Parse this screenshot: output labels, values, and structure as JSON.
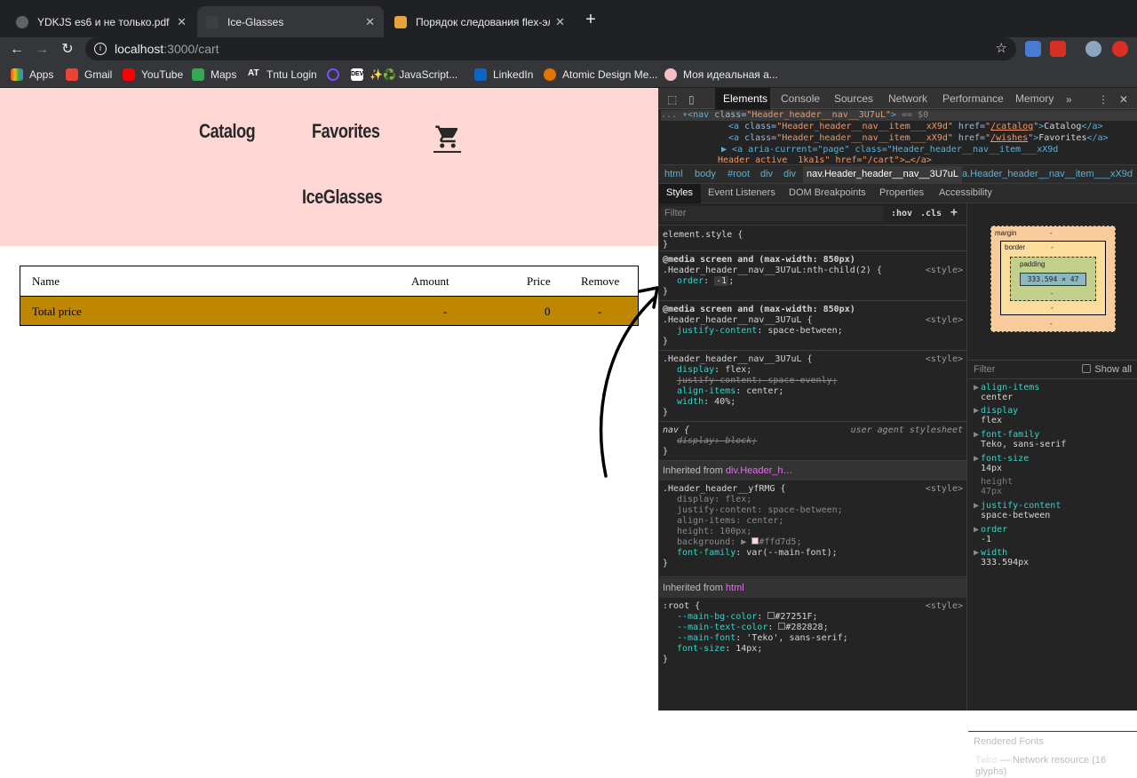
{
  "browser": {
    "tabs": [
      {
        "title": "YDKJS es6 и не только.pdf",
        "active": false
      },
      {
        "title": "Ice-Glasses",
        "active": true
      },
      {
        "title": "Порядок следования flex-эле",
        "active": false
      }
    ],
    "url_host": "localhost",
    "url_path": ":3000/cart",
    "bookmarks": [
      "Apps",
      "Gmail",
      "YouTube",
      "Maps",
      "Tntu Login",
      "",
      "✨♻️ JavaScript...",
      "LinkedIn",
      "Atomic Design Me...",
      "Моя идеальная а..."
    ]
  },
  "header": {
    "catalog": "Catalog",
    "favorites": "Favorites",
    "brand": "IceGlasses"
  },
  "cart_table": {
    "headers": {
      "name": "Name",
      "amount": "Amount",
      "price": "Price",
      "remove": "Remove"
    },
    "total": {
      "label": "Total price",
      "amount": "-",
      "price": "0",
      "remove": "-"
    }
  },
  "devtools": {
    "tabs": [
      "Elements",
      "Console",
      "Sources",
      "Network",
      "Performance",
      "Memory"
    ],
    "dom_lines": [
      {
        "prefix": "... ▾",
        "tag": "nav",
        "cls": "Header_header__nav__3U7uL",
        "suffix": "== $0"
      },
      {
        "a_cls": "Header_header__nav__item___xX9d",
        "href": "/catalog",
        "text": "Catalog"
      },
      {
        "a_cls": "Header_header__nav__item___xX9d",
        "href": "/wishes",
        "text": "Favorites"
      },
      {
        "line": "▶ <a aria-current=\"page\" class=\"Header_header__nav__item___xX9d"
      },
      {
        "line": "Header_active__1ka1s\" href=\"/cart\">…</a>"
      }
    ],
    "breadcrumbs": [
      "html",
      "body",
      "#root",
      "div",
      "div",
      "nav.Header_header__nav__3U7uL",
      "a.Header_header__nav__item___xX9d"
    ],
    "subtabs": [
      "Styles",
      "Event Listeners",
      "DOM Breakpoints",
      "Properties",
      "Accessibility"
    ],
    "filter_placeholder": "Filter",
    "hov": ":hov",
    "cls": ".cls",
    "rules": {
      "element_style": "element.style {",
      "media1": "@media screen and (max-width: 850px)",
      "sel1": ".Header_header__nav__3U7uL:nth-child(2) {",
      "p1": "order",
      "v1": "-1",
      "media2": "@media screen and (max-width: 850px)",
      "sel2": ".Header_header__nav__3U7uL {",
      "p2": "justify-content",
      "v2": "space-between",
      "sel3": ".Header_header__nav__3U7uL {",
      "p3a": "display",
      "v3a": "flex",
      "p3b": "justify-content",
      "v3b": "space-evenly",
      "p3c": "align-items",
      "v3c": "center",
      "p3d": "width",
      "v3d": "40%",
      "sel4": "nav {",
      "ua": "user agent stylesheet",
      "p4": "display",
      "v4": "block",
      "inh1_prefix": "Inherited from ",
      "inh1": "div.Header_h…",
      "sel5": ".Header_header__yfRMG {",
      "p5a": "display",
      "v5a": "flex",
      "p5b": "justify-content",
      "v5b": "space-between",
      "p5c": "align-items",
      "v5c": "center",
      "p5d": "height",
      "v5d": "100px",
      "p5e": "background",
      "v5e": "#ffd7d5",
      "p5f": "font-family",
      "v5f": "var(--main-font)",
      "inh2_prefix": "Inherited from ",
      "inh2": "html",
      "sel6": ":root {",
      "p6a": "--main-bg-color",
      "v6a": "#27251F",
      "p6b": "--main-text-color",
      "v6b": "#282828",
      "p6c": "--main-font",
      "v6c": "'Teko', sans-serif",
      "p6d": "font-size",
      "v6d": "14px",
      "style_src": "<style>",
      "close": "}"
    },
    "box_model": {
      "margin": "margin",
      "border": "border",
      "padding": "padding",
      "content": "333.594 × 47",
      "dash": "-"
    },
    "computed_filter": "Filter",
    "show_all": "Show all",
    "computed": [
      {
        "name": "align-items",
        "value": "center"
      },
      {
        "name": "display",
        "value": "flex"
      },
      {
        "name": "font-family",
        "value": "Teko, sans-serif"
      },
      {
        "name": "font-size",
        "value": "14px"
      },
      {
        "name": "height",
        "value": "47px"
      },
      {
        "name": "justify-content",
        "value": "space-between"
      },
      {
        "name": "order",
        "value": "-1"
      },
      {
        "name": "width",
        "value": "333.594px"
      }
    ],
    "rendered_fonts": "Rendered Fonts",
    "font_name": "Teko",
    "font_source": "— Network resource (16 glyphs)"
  },
  "colors": {
    "header_bg": "#ffd7d5",
    "total_row": "#bf8700"
  }
}
